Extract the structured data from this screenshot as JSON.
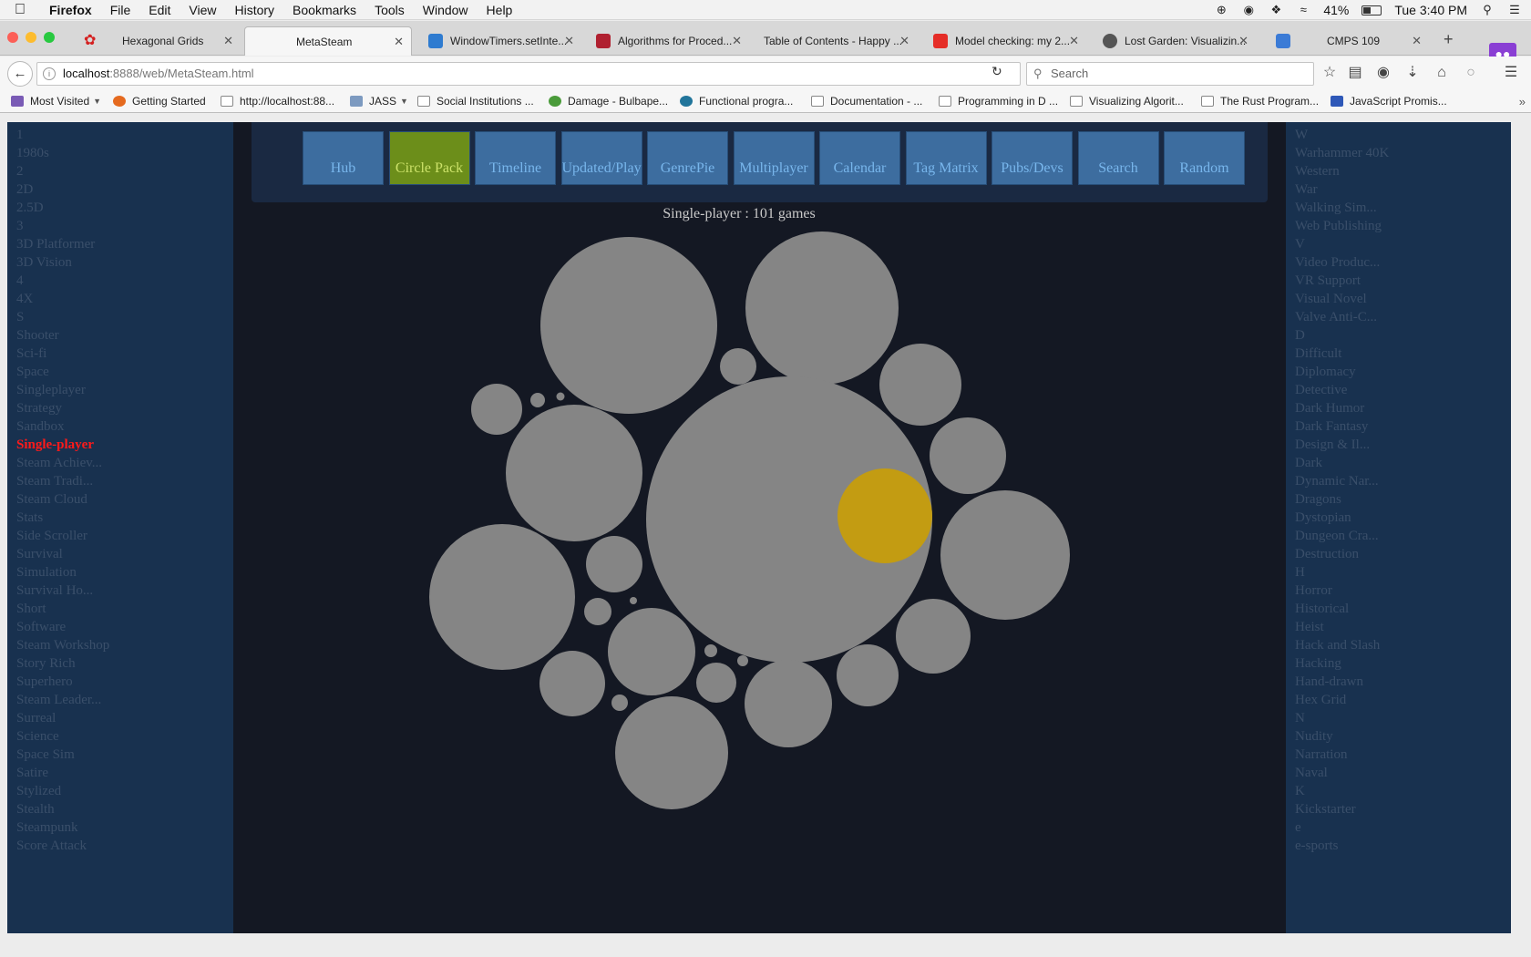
{
  "menubar": {
    "items": [
      "Firefox",
      "File",
      "Edit",
      "View",
      "History",
      "Bookmarks",
      "Tools",
      "Window",
      "Help"
    ],
    "battery": "41%",
    "clock": "Tue 3:40 PM"
  },
  "tabs": [
    {
      "label": "Hexagonal Grids",
      "favicon_color": "#d9262b"
    },
    {
      "label": "MetaSteam",
      "active": true
    },
    {
      "label": "WindowTimers.setInte...",
      "favicon_color": "#2e7bd0"
    },
    {
      "label": "Algorithms for Proced...",
      "favicon_color": "#b02030"
    },
    {
      "label": "Table of Contents - Happy ..."
    },
    {
      "label": "Model checking: my 2...",
      "favicon_color": "#e52d27"
    },
    {
      "label": "Lost Garden: Visualizin...",
      "favicon_color": "#555555"
    },
    {
      "label": "CMPS 109",
      "favicon_color": "#3b7bd6"
    }
  ],
  "url": {
    "host": "localhost",
    "path": ":8888/web/MetaSteam.html"
  },
  "search": {
    "placeholder": "Search"
  },
  "bookmarks": [
    {
      "label": "Most Visited",
      "dropdown": true
    },
    {
      "label": "Getting Started"
    },
    {
      "label": "http://localhost:88..."
    },
    {
      "label": "JASS",
      "dropdown": true
    },
    {
      "label": "Social Institutions ..."
    },
    {
      "label": "Damage - Bulbape..."
    },
    {
      "label": "Functional progra..."
    },
    {
      "label": "Documentation - ..."
    },
    {
      "label": "Programming in D ..."
    },
    {
      "label": "Visualizing Algorit..."
    },
    {
      "label": "The Rust Program..."
    },
    {
      "label": "JavaScript Promis..."
    }
  ],
  "left_tags": [
    "1",
    "1980s",
    "2",
    "2D",
    "2.5D",
    "3",
    "3D Platformer",
    "3D Vision",
    "4",
    "4X",
    "S",
    "Shooter",
    "Sci-fi",
    "Space",
    "Singleplayer",
    "Strategy",
    "Sandbox",
    "Single-player",
    "Steam Achiev...",
    "Steam Tradi...",
    "Steam Cloud",
    "Stats",
    "Side Scroller",
    "Survival",
    "Simulation",
    "Survival Ho...",
    "Short",
    "Software",
    "Steam Workshop",
    "Story Rich",
    "Superhero",
    "Steam Leader...",
    "Surreal",
    "Science",
    "Space Sim",
    "Satire",
    "Stylized",
    "Stealth",
    "Steampunk",
    "Score Attack"
  ],
  "selected_tag": "Single-player",
  "right_tags": [
    "W",
    "Warhammer 40K",
    "Western",
    "War",
    "Walking Sim...",
    "Web Publishing",
    "V",
    "Video Produc...",
    "VR Support",
    "Visual Novel",
    "Valve Anti-C...",
    "D",
    "Difficult",
    "Diplomacy",
    "Detective",
    "Dark Humor",
    "Dark Fantasy",
    "Design & Il...",
    "Dark",
    "Dynamic Nar...",
    "Dragons",
    "Dystopian",
    "Dungeon Cra...",
    "Destruction",
    "H",
    "Horror",
    "Historical",
    "Heist",
    "Hack and Slash",
    "Hacking",
    "Hand-drawn",
    "Hex Grid",
    "N",
    "Nudity",
    "Narration",
    "Naval",
    "K",
    "Kickstarter",
    "e",
    "e-sports"
  ],
  "nav_buttons": [
    "Hub",
    "Circle Pack",
    "Timeline",
    "Updated/Played",
    "GenrePie",
    "Multiplayer",
    "Calendar",
    "Tag Matrix",
    "Pubs/Devs",
    "Search",
    "Random"
  ],
  "active_view": "Circle Pack",
  "chart_title": "Single-player : 101 games",
  "colors": {
    "circle": "#858585",
    "highlight": "#c39c12",
    "active_button": "#6c8e1a",
    "selected_tag": "#ff1a1a"
  }
}
